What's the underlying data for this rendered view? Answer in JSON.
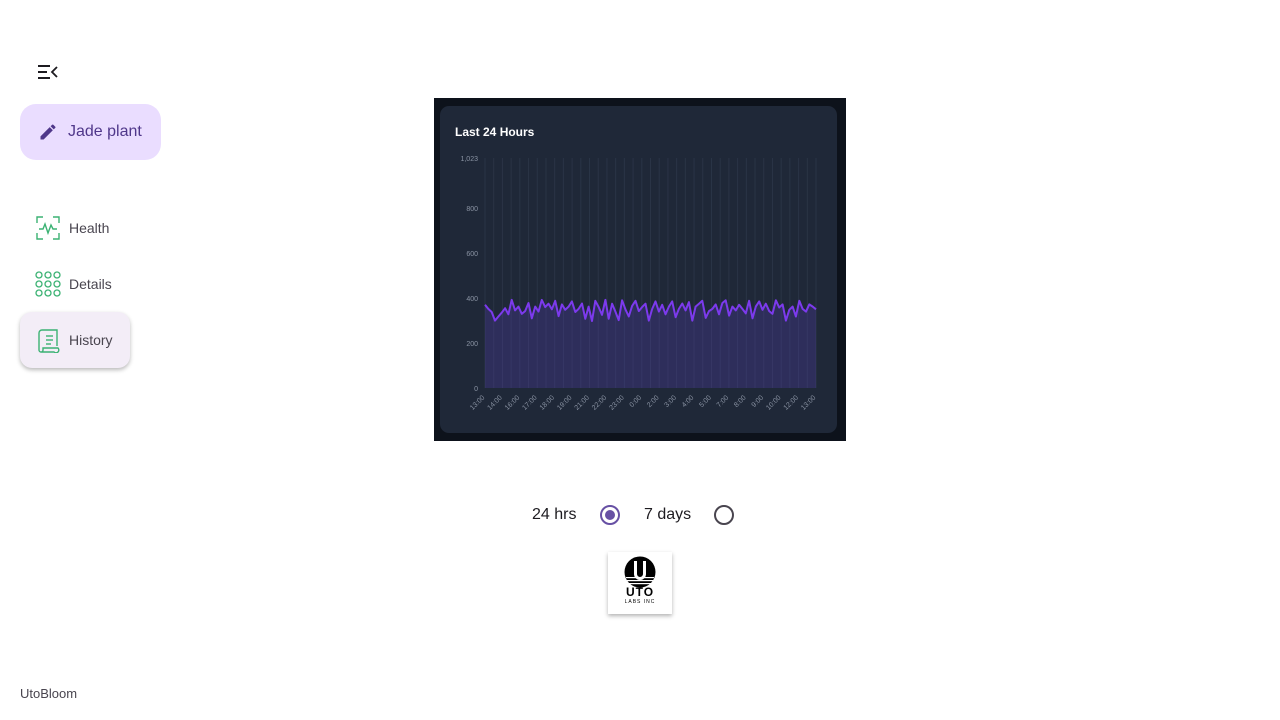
{
  "app": {
    "name": "UtoBloom"
  },
  "fab": {
    "label": "Jade plant",
    "icon": "pencil-icon"
  },
  "menu_icon": "menu-collapse-icon",
  "nav": {
    "items": [
      {
        "label": "Health",
        "icon": "heartbeat-monitor-icon",
        "active": false
      },
      {
        "label": "Details",
        "icon": "grid-dots-icon",
        "active": false
      },
      {
        "label": "History",
        "icon": "scroll-document-icon",
        "active": true
      }
    ]
  },
  "range_options": {
    "items": [
      {
        "label": "24 hrs",
        "selected": true
      },
      {
        "label": "7 days",
        "selected": false
      }
    ]
  },
  "logo": {
    "text": "UTO",
    "subtext": "LABS INC"
  },
  "colors": {
    "accent": "#6750a4",
    "fab_bg": "#eaddff",
    "line": "#7c3aed",
    "nav_icon": "#3bb273"
  },
  "chart_data": {
    "type": "area",
    "title": "Last 24 Hours",
    "xlabel": "",
    "ylabel": "",
    "ylim": [
      0,
      1023
    ],
    "y_ticks": [
      "0",
      "200",
      "400",
      "600",
      "800",
      "1,023"
    ],
    "y_tick_values": [
      0,
      200,
      400,
      600,
      800,
      1023
    ],
    "x_ticks": [
      "13:00",
      "14:00",
      "16:00",
      "17:00",
      "18:00",
      "19:00",
      "21:00",
      "22:00",
      "23:00",
      "0:00",
      "2:00",
      "3:00",
      "4:00",
      "5:00",
      "7:00",
      "8:00",
      "9:00",
      "10:00",
      "12:00",
      "13:00"
    ],
    "grid": true,
    "series": [
      {
        "values": [
          370,
          352,
          338,
          300,
          318,
          335,
          355,
          328,
          392,
          345,
          362,
          330,
          342,
          378,
          310,
          362,
          340,
          392,
          360,
          375,
          350,
          388,
          320,
          372,
          348,
          362,
          385,
          338,
          352,
          376,
          308,
          362,
          298,
          388,
          360,
          325,
          392,
          308,
          375,
          340,
          302,
          390,
          350,
          318,
          365,
          388,
          342,
          360,
          375,
          300,
          352,
          385,
          340,
          370,
          328,
          362,
          385,
          315,
          352,
          376,
          345,
          382,
          300,
          362,
          375,
          388,
          312,
          342,
          352,
          372,
          328,
          378,
          390,
          322,
          362,
          345,
          370,
          352,
          332,
          388,
          310,
          362,
          385,
          348,
          375,
          342,
          330,
          390,
          358,
          372,
          300,
          348,
          362,
          318,
          388,
          352,
          340,
          372,
          362,
          350
        ]
      }
    ]
  }
}
